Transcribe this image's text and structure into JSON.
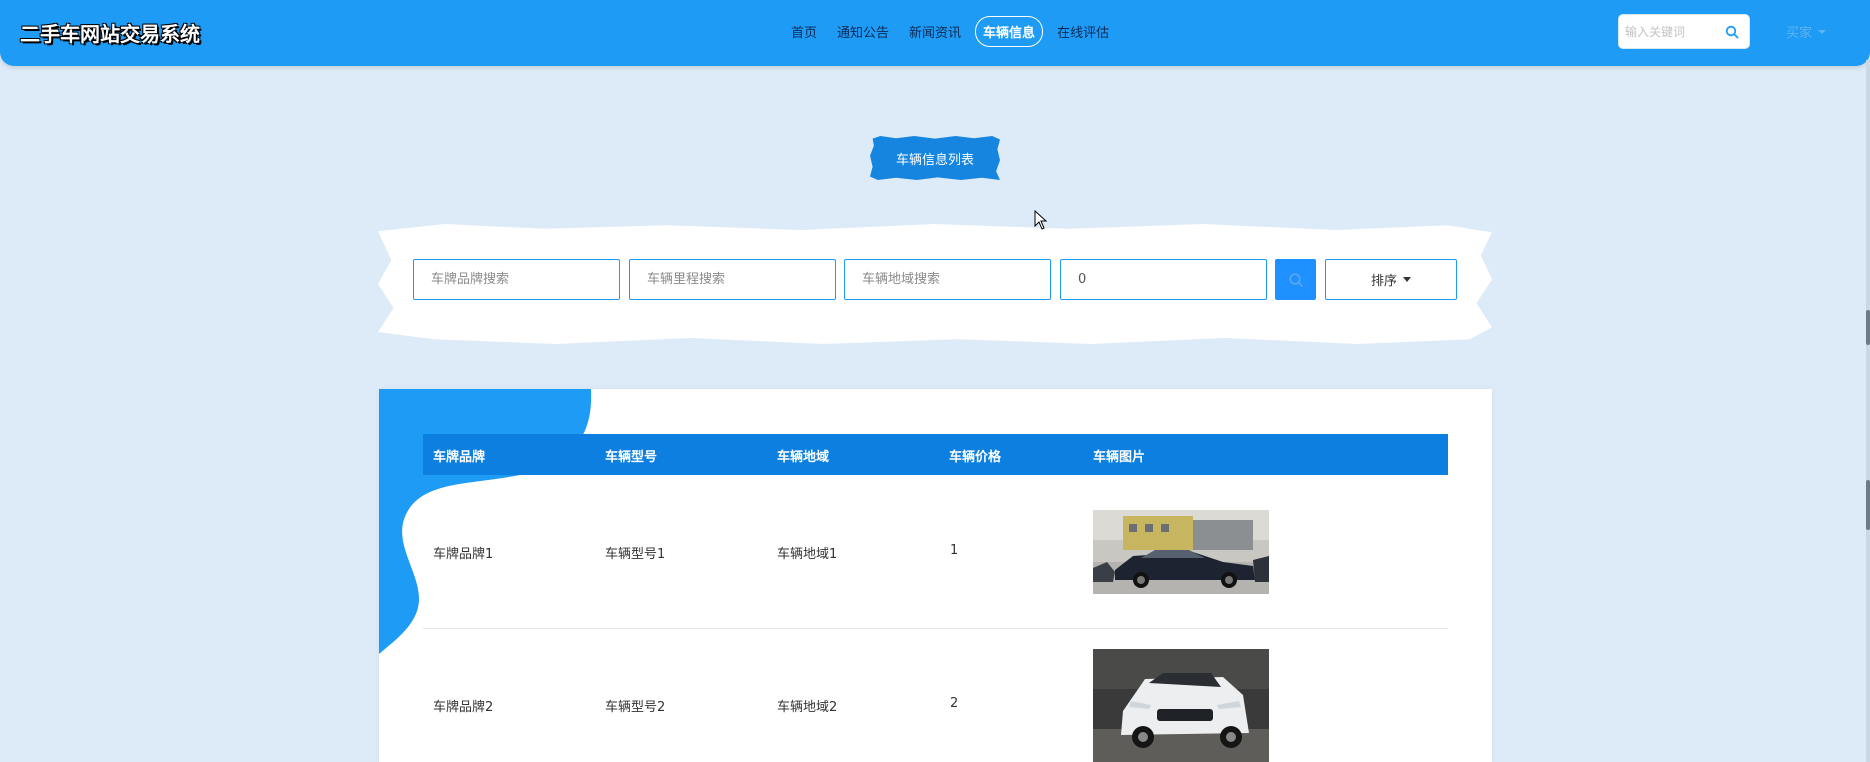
{
  "header": {
    "site_title": "二手车网站交易系统",
    "nav": [
      {
        "label": "首页",
        "active": false
      },
      {
        "label": "通知公告",
        "active": false
      },
      {
        "label": "新闻资讯",
        "active": false
      },
      {
        "label": "车辆信息",
        "active": true
      },
      {
        "label": "在线评估",
        "active": false
      }
    ],
    "search_placeholder": "输入关键词",
    "user_menu": "买家"
  },
  "section": {
    "title": "车辆信息列表"
  },
  "filters": {
    "brand_placeholder": "车牌品牌搜索",
    "mileage_placeholder": "车辆里程搜索",
    "region_placeholder": "车辆地域搜索",
    "price_value": "0",
    "sort_label": "排序"
  },
  "table": {
    "columns": [
      "车牌品牌",
      "车辆型号",
      "车辆地域",
      "车辆价格",
      "车辆图片"
    ],
    "rows": [
      {
        "brand": "车牌品牌1",
        "model": "车辆型号1",
        "region": "车辆地域1",
        "price": "1",
        "image": "black-sedan-photo"
      },
      {
        "brand": "车牌品牌2",
        "model": "车辆型号2",
        "region": "车辆地域2",
        "price": "2",
        "image": "white-suv-photo"
      }
    ]
  },
  "colors": {
    "header_bg": "#1e9bf5",
    "page_bg": "#ddebf8",
    "table_head_bg": "#0c7fe0",
    "accent_blob": "#1e9bf5",
    "search_button": "#1e90ff"
  },
  "icons": {
    "top_search": "search-icon",
    "filter_search": "search-icon",
    "sort_caret": "caret-down-icon",
    "user_caret": "chevron-down-icon"
  }
}
